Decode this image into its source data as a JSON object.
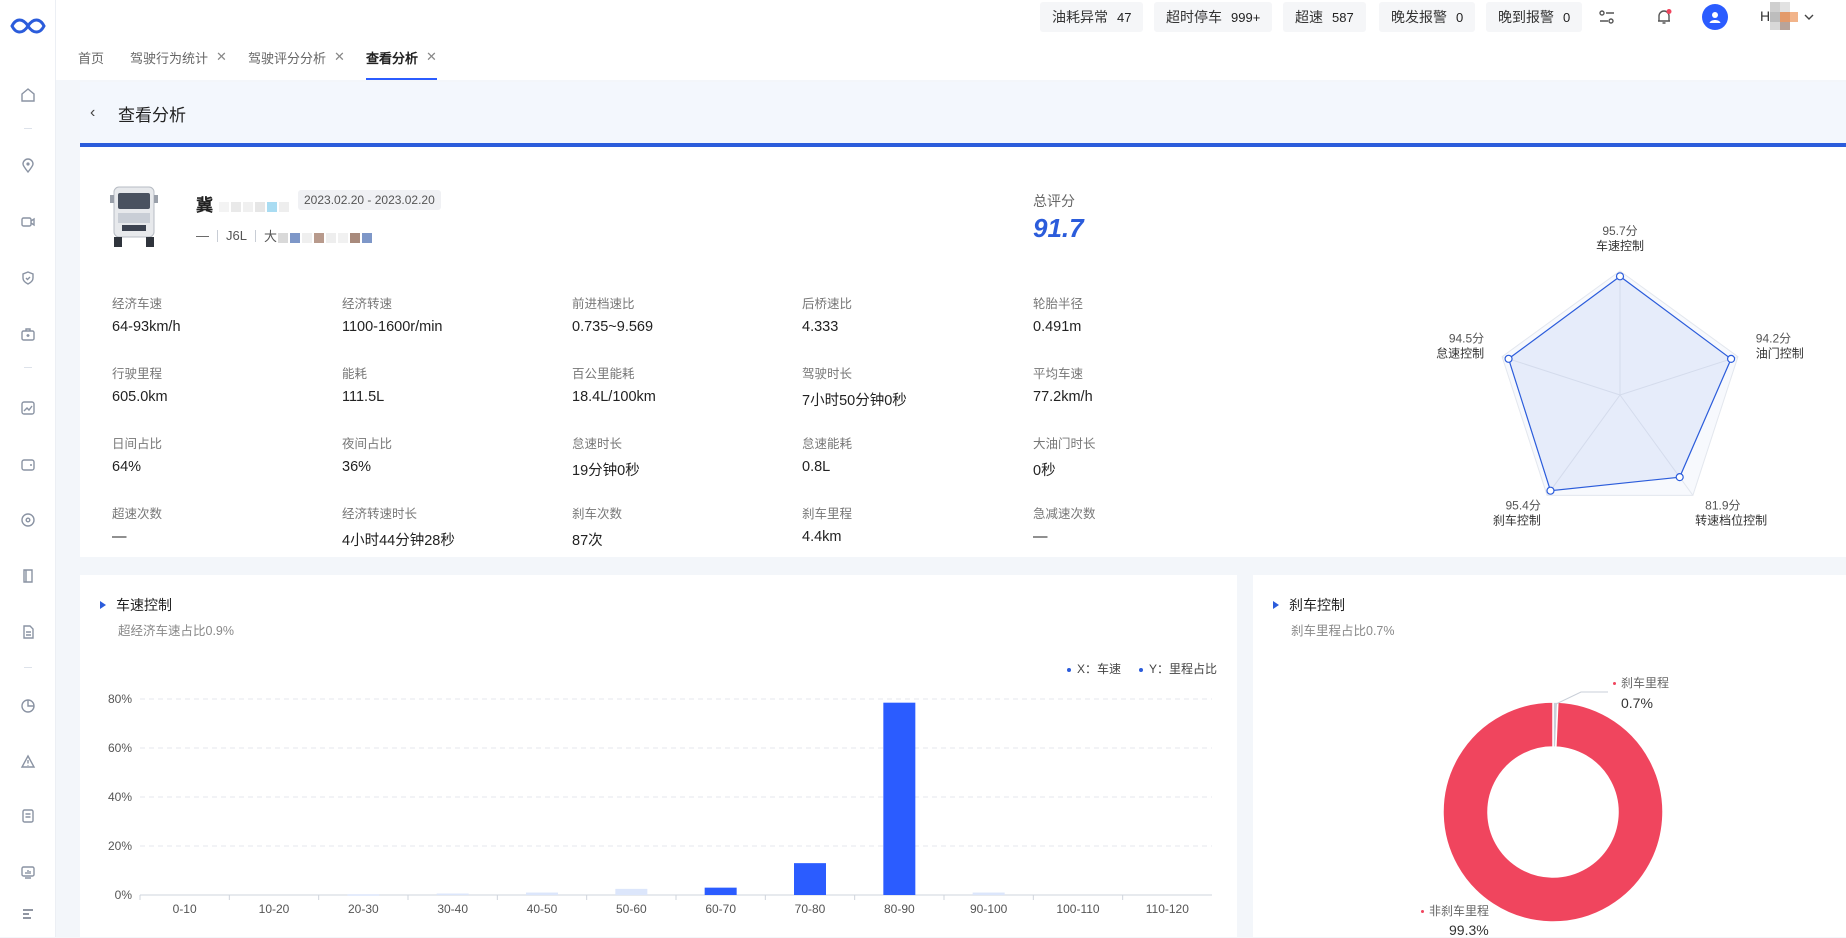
{
  "topbar": {
    "badges": [
      {
        "label": "油耗异常",
        "value": "47"
      },
      {
        "label": "超时停车",
        "value": "999+"
      },
      {
        "label": "超速",
        "value": "587"
      },
      {
        "label": "晚发报警",
        "value": "0"
      },
      {
        "label": "晚到报警",
        "value": "0"
      }
    ],
    "user_initial": "H"
  },
  "tabs": [
    {
      "label": "首页"
    },
    {
      "label": "驾驶行为统计"
    },
    {
      "label": "驾驶评分分析"
    },
    {
      "label": "查看分析"
    }
  ],
  "page": {
    "title": "查看分析"
  },
  "vehicle": {
    "plate_prefix": "冀",
    "date_range": "2023.02.20 - 2023.02.20",
    "driver": "—",
    "model": "J6L",
    "company_prefix": "大"
  },
  "score": {
    "label": "总评分",
    "value": "91.7"
  },
  "metrics": [
    {
      "label": "经济车速",
      "value": "64-93km/h"
    },
    {
      "label": "经济转速",
      "value": "1100-1600r/min"
    },
    {
      "label": "前进档速比",
      "value": "0.735~9.569"
    },
    {
      "label": "后桥速比",
      "value": "4.333"
    },
    {
      "label": "轮胎半径",
      "value": "0.491m"
    },
    {
      "label": "行驶里程",
      "value": "605.0km"
    },
    {
      "label": "能耗",
      "value": "111.5L"
    },
    {
      "label": "百公里能耗",
      "value": "18.4L/100km"
    },
    {
      "label": "驾驶时长",
      "value": "7小时50分钟0秒"
    },
    {
      "label": "平均车速",
      "value": "77.2km/h"
    },
    {
      "label": "日间占比",
      "value": "64%"
    },
    {
      "label": "夜间占比",
      "value": "36%"
    },
    {
      "label": "怠速时长",
      "value": "19分钟0秒"
    },
    {
      "label": "怠速能耗",
      "value": "0.8L"
    },
    {
      "label": "大油门时长",
      "value": "0秒"
    },
    {
      "label": "超速次数",
      "value": "—"
    },
    {
      "label": "经济转速时长",
      "value": "4小时44分钟28秒"
    },
    {
      "label": "刹车次数",
      "value": "87次"
    },
    {
      "label": "刹车里程",
      "value": "4.4km"
    },
    {
      "label": "急减速次数",
      "value": "—"
    }
  ],
  "radar": {
    "max": 100,
    "axes": [
      {
        "name": "车速控制",
        "score": 95.7,
        "score_label": "95.7分"
      },
      {
        "name": "油门控制",
        "score": 94.2,
        "score_label": "94.2分"
      },
      {
        "name": "转速档位控制",
        "score": 81.9,
        "score_label": "81.9分"
      },
      {
        "name": "刹车控制",
        "score": 95.4,
        "score_label": "95.4分"
      },
      {
        "name": "怠速控制",
        "score": 94.5,
        "score_label": "94.5分"
      }
    ],
    "color": "#2b5cdb"
  },
  "speed_card": {
    "title": "车速控制",
    "subtitle": "超经济车速占比0.9%",
    "legend": [
      "X：车速",
      "Y：里程占比"
    ]
  },
  "brake_card": {
    "title": "刹车控制",
    "subtitle": "刹车里程占比0.7%",
    "slices": [
      {
        "name": "刹车里程",
        "value": 0.7,
        "label": "0.7%",
        "color": "#c9cfd8"
      },
      {
        "name": "非刹车里程",
        "value": 99.3,
        "label": "99.3%",
        "color": "#f0455e"
      }
    ]
  },
  "chart_data": {
    "type": "bar",
    "categories": [
      "0-10",
      "10-20",
      "20-30",
      "30-40",
      "40-50",
      "50-60",
      "60-70",
      "70-80",
      "80-90",
      "90-100",
      "100-110",
      "110-120"
    ],
    "values": [
      0,
      0,
      0.3,
      0.6,
      1.0,
      2.5,
      3.0,
      13.0,
      78.5,
      1.0,
      0,
      0
    ],
    "highlight": [
      false,
      false,
      false,
      false,
      false,
      false,
      true,
      true,
      true,
      false,
      false,
      false
    ],
    "yticks": [
      "0%",
      "20%",
      "40%",
      "60%",
      "80%"
    ],
    "ylim": [
      0,
      80
    ],
    "grid": true,
    "color": "#2b5cff",
    "muted_color": "#dce6fb"
  }
}
